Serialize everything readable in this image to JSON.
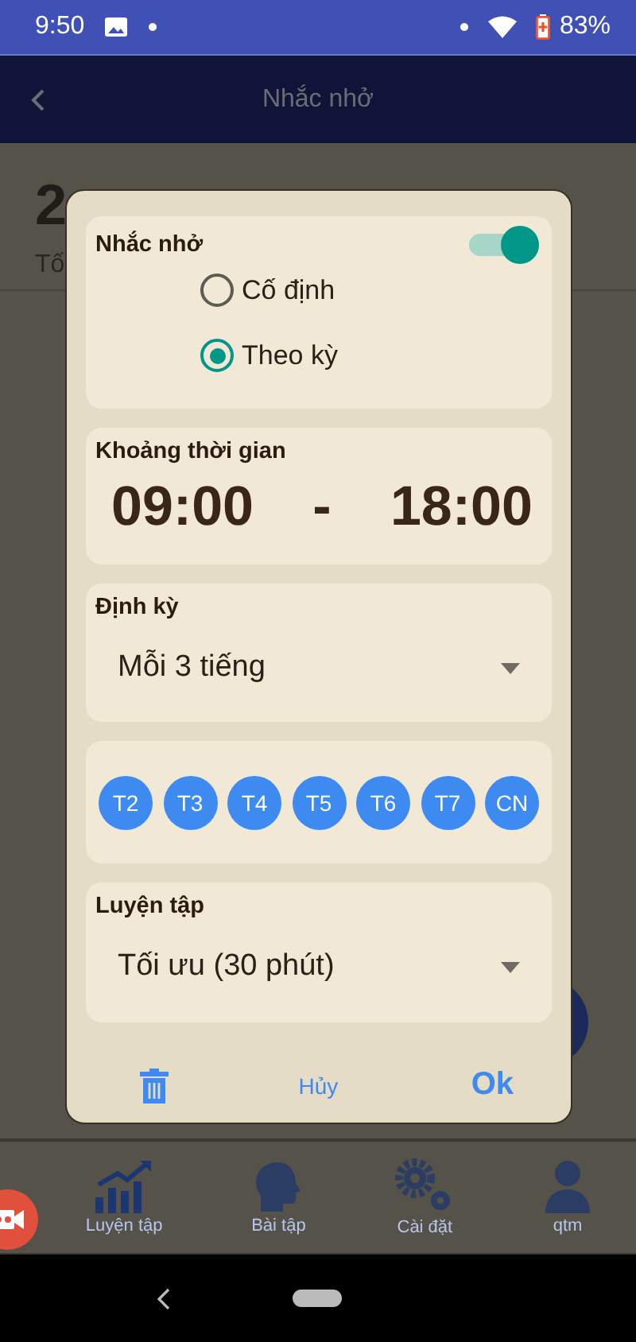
{
  "status_bar": {
    "time": "9:50",
    "battery": "83%"
  },
  "header": {
    "title": "Nhắc nhở"
  },
  "background": {
    "time": "2",
    "label": "Tố"
  },
  "dialog": {
    "reminder": {
      "title": "Nhắc nhở",
      "on": true,
      "options": [
        {
          "label": "Cố định",
          "selected": false
        },
        {
          "label": "Theo kỳ",
          "selected": true
        }
      ]
    },
    "range": {
      "title": "Khoảng thời gian",
      "start": "09:00",
      "separator": "-",
      "end": "18:00"
    },
    "period": {
      "title": "Định kỳ",
      "value": "Mỗi 3 tiếng"
    },
    "days": [
      {
        "label": "T2",
        "selected": true
      },
      {
        "label": "T3",
        "selected": true
      },
      {
        "label": "T4",
        "selected": true
      },
      {
        "label": "T5",
        "selected": true
      },
      {
        "label": "T6",
        "selected": true
      },
      {
        "label": "T7",
        "selected": true
      },
      {
        "label": "CN",
        "selected": true
      }
    ],
    "practice": {
      "title": "Luyện tập",
      "value": "Tối ưu (30 phút)"
    },
    "buttons": {
      "cancel": "Hủy",
      "ok": "Ok"
    }
  },
  "bottom_nav": [
    {
      "kind": "chart",
      "label": "Luyện tập"
    },
    {
      "kind": "head",
      "label": "Bài tập"
    },
    {
      "kind": "gears",
      "label": "Cài đặt"
    },
    {
      "kind": "person",
      "label": "qtm"
    }
  ]
}
